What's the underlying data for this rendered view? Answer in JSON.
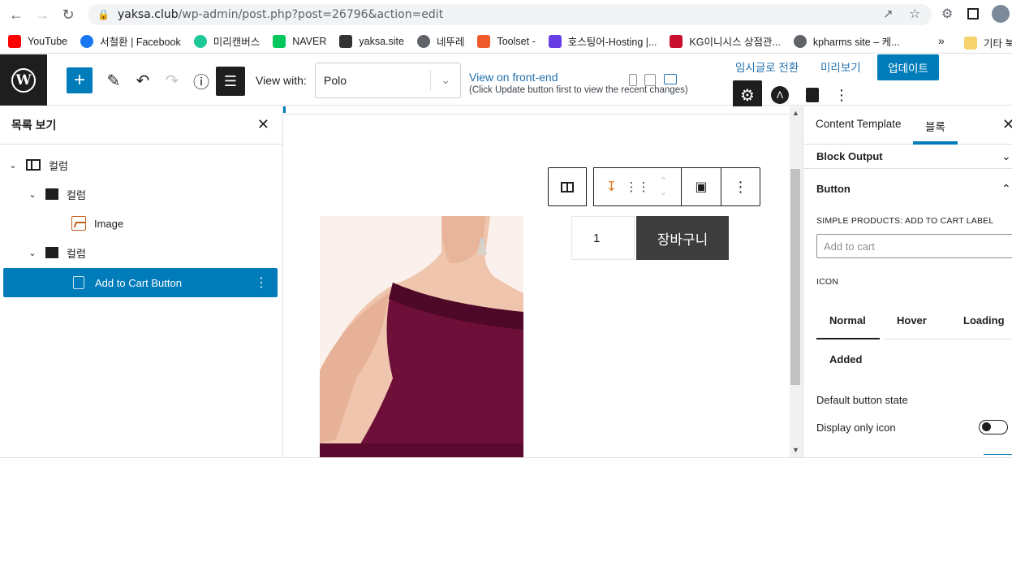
{
  "browser": {
    "url_host": "yaksa.club",
    "url_path": "/wp-admin/post.php?post=26796&action=edit",
    "bookmarks": [
      {
        "label": "YouTube",
        "color": "#ff0000"
      },
      {
        "label": "서철환 | Facebook",
        "color": "#1877f2"
      },
      {
        "label": "미리캔버스",
        "color": "#1ec997"
      },
      {
        "label": "NAVER",
        "color": "#03c75a"
      },
      {
        "label": "yaksa.site",
        "color": "#333333"
      },
      {
        "label": "네뚜레",
        "color": "#5f6368"
      },
      {
        "label": "Toolset -",
        "color": "#f0592a"
      },
      {
        "label": "호스팅어-Hosting |...",
        "color": "#673de6"
      },
      {
        "label": "KG이니시스 상점관...",
        "color": "#c8102e"
      },
      {
        "label": "kpharms site – 케...",
        "color": "#5f6368"
      }
    ],
    "more_label": "»",
    "other_bookmarks": "기타 북"
  },
  "header": {
    "view_with_label": "View with:",
    "view_select_value": "Polo",
    "front_end_link": "View on front-end",
    "front_end_note": "(Click Update button first to view the recent changes)",
    "save_draft": "임시글로 전환",
    "preview": "미리보기",
    "update": "업데이트"
  },
  "listview": {
    "title": "목록 보기",
    "items": [
      {
        "label": "컬럼"
      },
      {
        "label": "컬럼"
      },
      {
        "label": "Image"
      },
      {
        "label": "컬럼"
      },
      {
        "label": "Add to Cart Button"
      }
    ]
  },
  "canvas": {
    "quantity": "1",
    "add_to_cart": "장바구니"
  },
  "sidebar": {
    "tab_template": "Content Template",
    "tab_block": "블록",
    "block_output": "Block Output",
    "button_section": "Button",
    "cart_label_title": "SIMPLE PRODUCTS: ADD TO CART LABEL",
    "cart_label_placeholder": "Add to cart",
    "icon_title": "ICON",
    "state_tabs": [
      "Normal",
      "Hover",
      "Loading",
      "Added"
    ],
    "default_state": "Default button state",
    "display_only_icon": "Display only icon",
    "display_only_icon_on": false
  },
  "colors": {
    "accent": "#007cba",
    "dark": "#1e1e1e",
    "cart_button": "#3d3d3d",
    "dress": "#6e0f3a"
  }
}
